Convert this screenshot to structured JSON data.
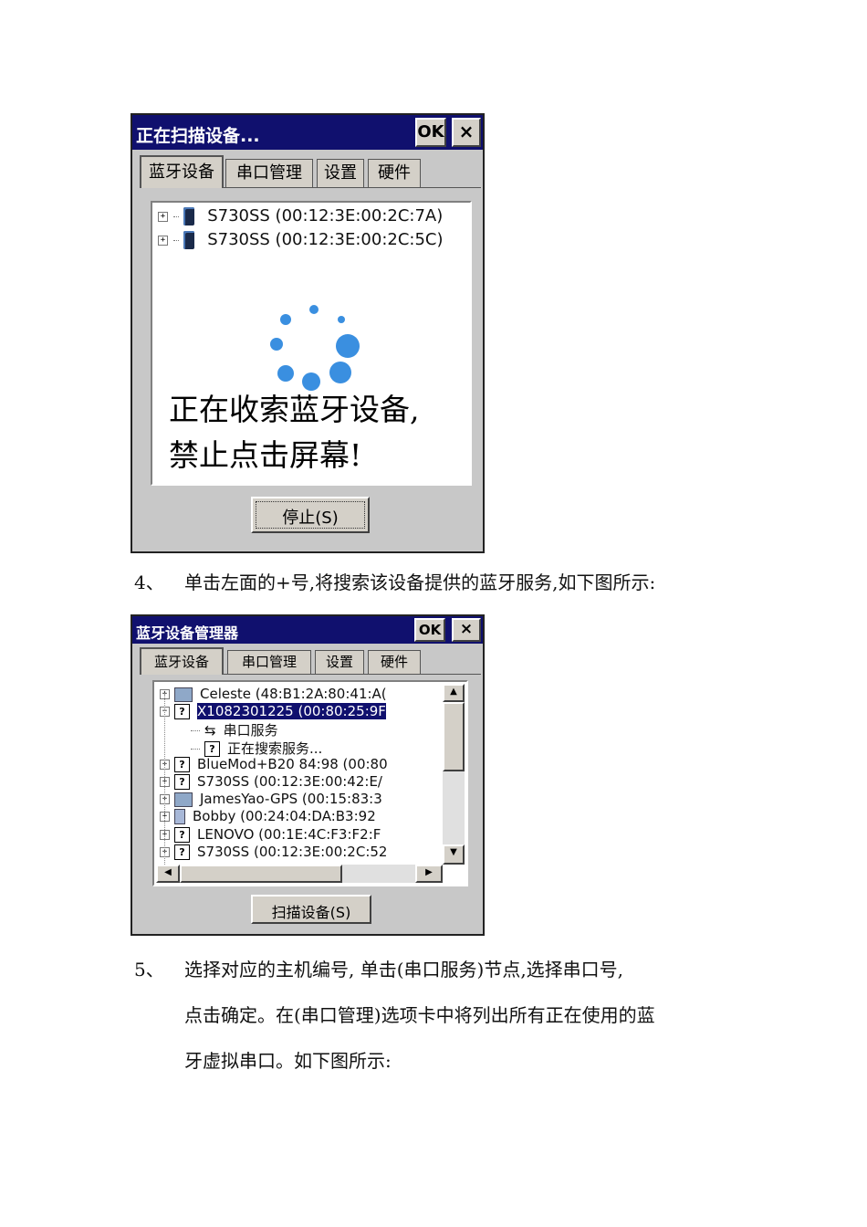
{
  "dialog1": {
    "title": "正在扫描设备...",
    "ok_label": "OK",
    "close_label": "×",
    "tabs": [
      "蓝牙设备",
      "串口管理",
      "设置",
      "硬件"
    ],
    "devices": [
      "S730SS (00:12:3E:00:2C:7A)",
      "S730SS (00:12:3E:00:2C:5C)"
    ],
    "overlay_line1": "正在收索蓝牙设备,",
    "overlay_line2": "禁止点击屏幕!",
    "stop_button": "停止(S)"
  },
  "step4": {
    "number": "4、",
    "text": "单击左面的+号,将搜索该设备提供的蓝牙服务,如下图所示:"
  },
  "dialog2": {
    "title": "蓝牙设备管理器",
    "ok_label": "OK",
    "close_label": "×",
    "tabs": [
      "蓝牙设备",
      "串口管理",
      "设置",
      "硬件"
    ],
    "tree": [
      {
        "pm": "+",
        "icon": "pc",
        "label": "Celeste (48:B1:2A:80:41:A(",
        "child": false,
        "selected": false
      },
      {
        "pm": "−",
        "icon": "q",
        "label": "X1082301225 (00:80:25:9F",
        "child": false,
        "selected": true
      },
      {
        "pm": "",
        "icon": "serial",
        "label": "串口服务",
        "child": true,
        "selected": false
      },
      {
        "pm": "",
        "icon": "q",
        "label": "正在搜索服务...",
        "child": true,
        "selected": false
      },
      {
        "pm": "+",
        "icon": "q",
        "label": "BlueMod+B20 84:98 (00:80",
        "child": false,
        "selected": false
      },
      {
        "pm": "+",
        "icon": "q",
        "label": "S730SS (00:12:3E:00:42:E/",
        "child": false,
        "selected": false
      },
      {
        "pm": "+",
        "icon": "pc",
        "label": "JamesYao-GPS (00:15:83:3",
        "child": false,
        "selected": false
      },
      {
        "pm": "+",
        "icon": "pda",
        "label": "Bobby (00:24:04:DA:B3:92",
        "child": false,
        "selected": false
      },
      {
        "pm": "+",
        "icon": "q",
        "label": "LENOVO (00:1E:4C:F3:F2:F",
        "child": false,
        "selected": false
      },
      {
        "pm": "+",
        "icon": "q",
        "label": "S730SS (00:12:3E:00:2C:52",
        "child": false,
        "selected": false
      }
    ],
    "scan_button": "扫描设备(S)"
  },
  "step5": {
    "number": "5、",
    "line1": "选择对应的主机编号, 单击(串口服务)节点,选择串口号,",
    "line2": "点击确定。在(串口管理)选项卡中将列出所有正在使用的蓝",
    "line3": "牙虚拟串口。如下图所示:"
  },
  "colors": {
    "titlebar": "#10106e",
    "dialog_bg": "#c8c8c8",
    "spinner": "#3a8fe0",
    "selection": "#10106e"
  }
}
